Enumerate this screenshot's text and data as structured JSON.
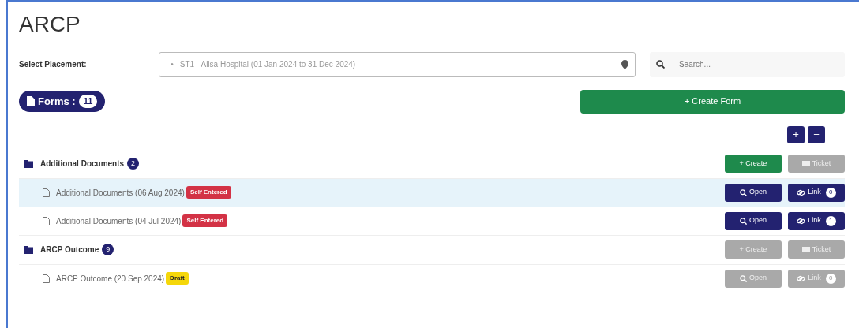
{
  "title": "ARCP",
  "placement": {
    "label": "Select Placement:",
    "bullet": "•",
    "value": "ST1 - Ailsa Hospital (01 Jan 2024 to 31 Dec 2024)"
  },
  "search": {
    "placeholder": "Search..."
  },
  "forms_count": {
    "label": "Forms :",
    "count": "11"
  },
  "create_form": "+ Create Form",
  "expand_button": "+",
  "collapse_button": "−",
  "groups": [
    {
      "name": "Additional Documents",
      "count": "2",
      "create": {
        "label": "+ Create",
        "disabled": false
      },
      "ticket": {
        "label": "Ticket",
        "disabled": true
      },
      "items": [
        {
          "title": "Additional Documents (06 Aug 2024)",
          "badge": {
            "kind": "self",
            "label": "Self Entered"
          },
          "selected": true,
          "open": {
            "label": "Open",
            "disabled": false
          },
          "link": {
            "label": "Link",
            "count": "0",
            "disabled": false
          }
        },
        {
          "title": "Additional Documents (04 Jul 2024)",
          "badge": {
            "kind": "self",
            "label": "Self Entered"
          },
          "selected": false,
          "open": {
            "label": "Open",
            "disabled": false
          },
          "link": {
            "label": "Link",
            "count": "1",
            "disabled": false
          }
        }
      ]
    },
    {
      "name": "ARCP Outcome",
      "count": "9",
      "create": {
        "label": "+ Create",
        "disabled": true
      },
      "ticket": {
        "label": "Ticket",
        "disabled": true
      },
      "items": [
        {
          "title": "ARCP Outcome (20 Sep 2024)",
          "badge": {
            "kind": "draft",
            "label": "Draft"
          },
          "selected": false,
          "open": {
            "label": "Open",
            "disabled": true
          },
          "link": {
            "label": "Link",
            "count": "0",
            "disabled": true
          }
        }
      ]
    }
  ]
}
